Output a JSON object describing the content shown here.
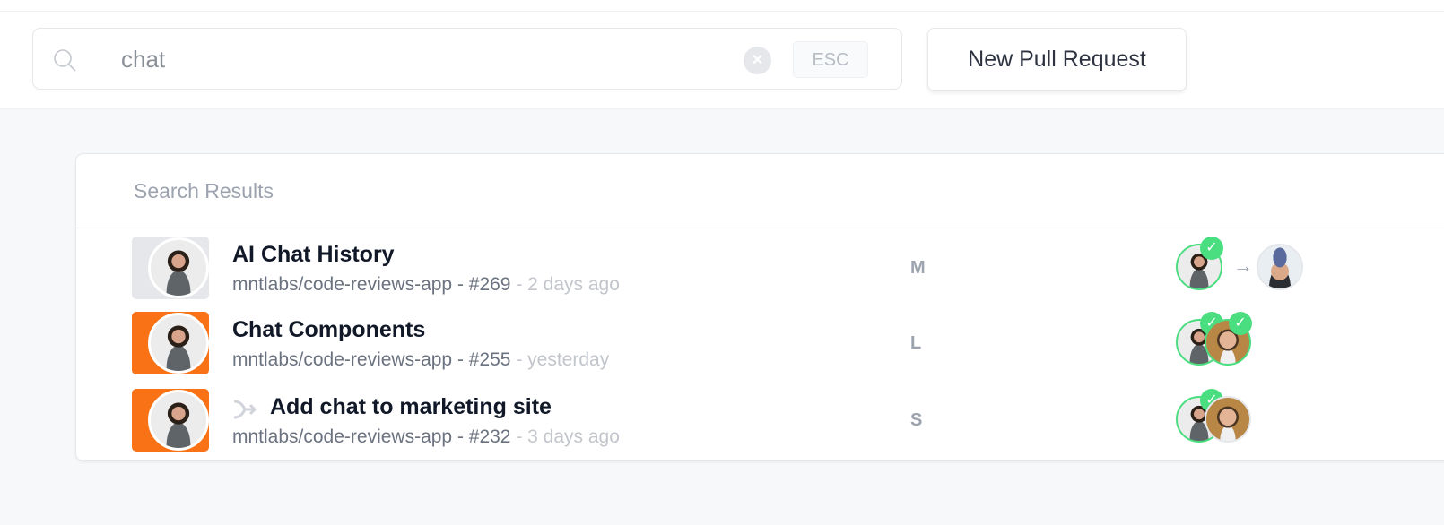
{
  "header": {
    "search": {
      "value": "chat",
      "icon": "search-icon",
      "clear_icon": "×",
      "esc_label": "ESC"
    },
    "new_pr_label": "New Pull Request"
  },
  "results": {
    "title": "Search Results",
    "accent_orange": "#f97316",
    "approved_green": "#4ade80",
    "rows": [
      {
        "title": "AI Chat History",
        "repo": "mntlabs/code-reviews-app - #269",
        "time": "- 2 days ago",
        "size": "M",
        "status_color": "#e5e7eb",
        "merged": false,
        "arrow": "→",
        "check": "✓"
      },
      {
        "title": "Chat Components",
        "repo": "mntlabs/code-reviews-app - #255",
        "time": "- yesterday",
        "size": "L",
        "status_color": "#f97316",
        "merged": false,
        "check": "✓"
      },
      {
        "title": "Add chat to marketing site",
        "repo": "mntlabs/code-reviews-app - #232",
        "time": "- 3 days ago",
        "size": "S",
        "status_color": "#f97316",
        "merged": true,
        "check": "✓"
      }
    ]
  }
}
